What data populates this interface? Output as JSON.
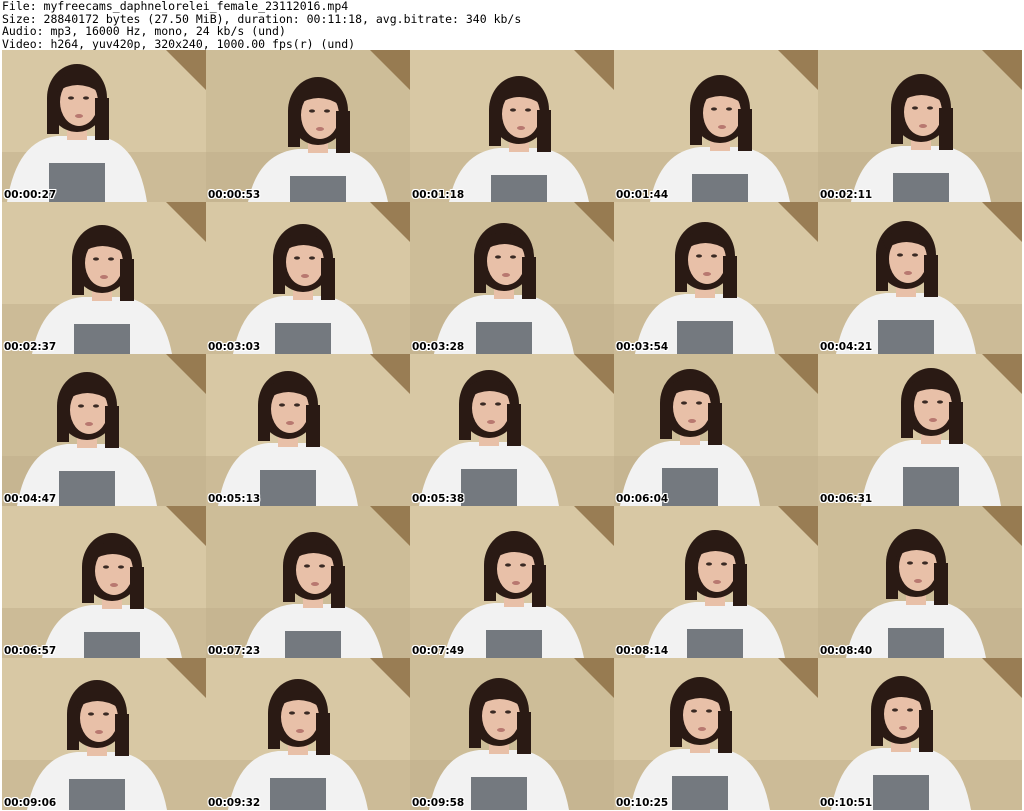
{
  "header": {
    "file_line": "File: myfreecams_daphnelorelei_female_23112016.mp4",
    "size_line": "Size: 28840172 bytes (27.50 MiB), duration: 00:11:18, avg.bitrate: 340 kb/s",
    "audio_line": "Audio: mp3, 16000 Hz, mono, 24 kb/s (und)",
    "video_line": "Video: h264, yuv420p, 320x240, 1000.00 fps(r) (und)"
  },
  "thumbnails": [
    {
      "timestamp": "00:00:27"
    },
    {
      "timestamp": "00:00:53"
    },
    {
      "timestamp": "00:01:18"
    },
    {
      "timestamp": "00:01:44"
    },
    {
      "timestamp": "00:02:11"
    },
    {
      "timestamp": "00:02:37"
    },
    {
      "timestamp": "00:03:03"
    },
    {
      "timestamp": "00:03:28"
    },
    {
      "timestamp": "00:03:54"
    },
    {
      "timestamp": "00:04:21"
    },
    {
      "timestamp": "00:04:47"
    },
    {
      "timestamp": "00:05:13"
    },
    {
      "timestamp": "00:05:38"
    },
    {
      "timestamp": "00:06:04"
    },
    {
      "timestamp": "00:06:31"
    },
    {
      "timestamp": "00:06:57"
    },
    {
      "timestamp": "00:07:23"
    },
    {
      "timestamp": "00:07:49"
    },
    {
      "timestamp": "00:08:14"
    },
    {
      "timestamp": "00:08:40"
    },
    {
      "timestamp": "00:09:06"
    },
    {
      "timestamp": "00:09:32"
    },
    {
      "timestamp": "00:09:58"
    },
    {
      "timestamp": "00:10:25"
    },
    {
      "timestamp": "00:10:51"
    }
  ],
  "colors": {
    "wall": "#d8c8a4",
    "hair": "#2a1a14",
    "skin": "#e8c0a8",
    "shirt": "#f2f2f2",
    "print": "#4a5058",
    "shelf": "#8a6a40"
  }
}
